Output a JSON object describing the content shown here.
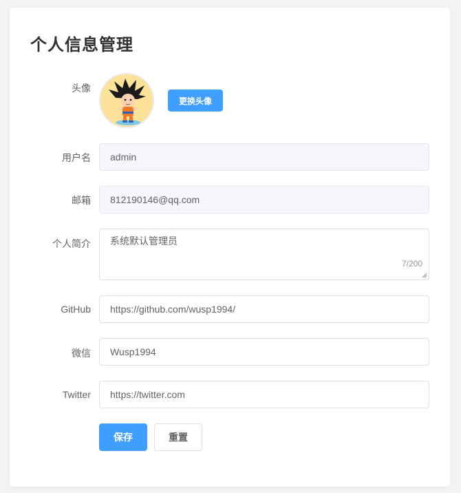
{
  "page": {
    "title": "个人信息管理"
  },
  "form": {
    "avatar": {
      "label": "头像",
      "change_button": "更换头像"
    },
    "username": {
      "label": "用户名",
      "value": "admin"
    },
    "email": {
      "label": "邮箱",
      "value": "812190146@qq.com"
    },
    "bio": {
      "label": "个人简介",
      "value": "系统默认管理员",
      "counter": "7/200"
    },
    "github": {
      "label": "GitHub",
      "value": "https://github.com/wusp1994/"
    },
    "wechat": {
      "label": "微信",
      "value": "Wusp1994"
    },
    "twitter": {
      "label": "Twitter",
      "value": "https://twitter.com"
    }
  },
  "actions": {
    "save": "保存",
    "reset": "重置"
  },
  "colors": {
    "primary": "#409eff",
    "disabled_bg": "#f5f7fa",
    "border": "#dcdfe6"
  }
}
